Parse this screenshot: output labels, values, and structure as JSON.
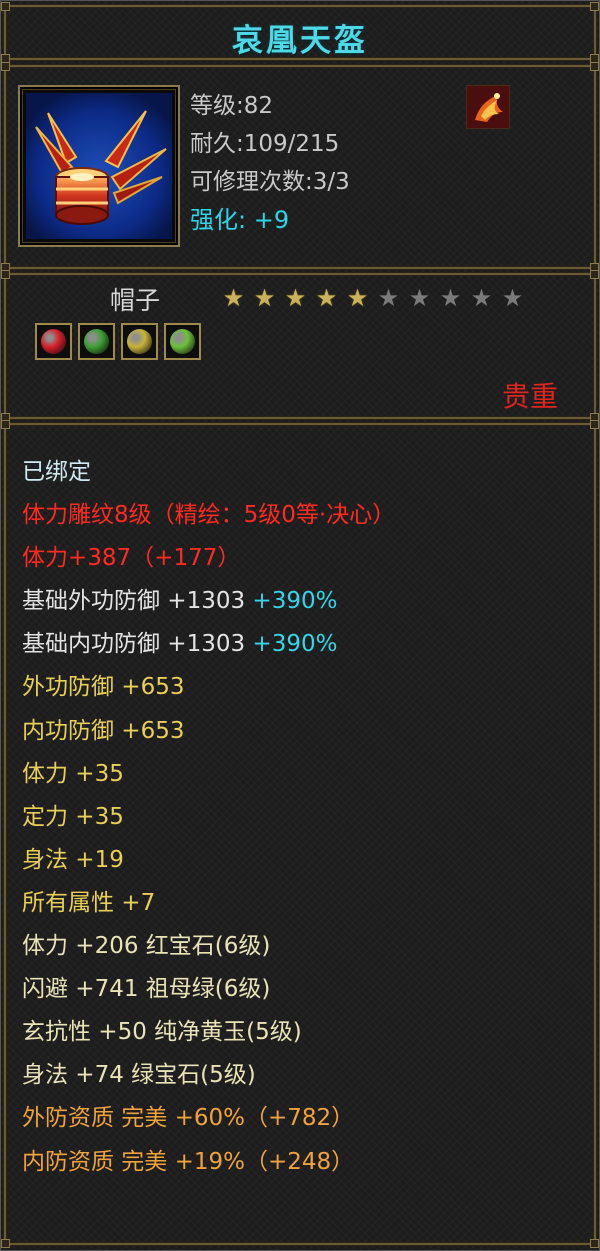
{
  "title": "哀凰天盔",
  "item": {
    "icon": "phoenix-helmet-icon",
    "level": "等级:82",
    "durability": "耐久:109/215",
    "repair_count": "可修理次数:3/3",
    "enhance_label": "强化:",
    "enhance_value": "+9",
    "badge_icon": "phoenix-badge-icon"
  },
  "meta": {
    "type": "帽子",
    "stars_filled": 5,
    "stars_total": 10,
    "rarity": "贵重",
    "gems": [
      {
        "icon": "red-gem-icon",
        "color": "#d8202a"
      },
      {
        "icon": "green-gem-icon",
        "color": "#3fa035"
      },
      {
        "icon": "yellow-gem-icon",
        "color": "#c8b43a"
      },
      {
        "icon": "lime-gem-icon",
        "color": "#6cc03a"
      }
    ]
  },
  "stats": [
    {
      "text": "已绑定",
      "extra": "",
      "color": "#cfe9f0"
    },
    {
      "text": "体力雕纹8级（精绘：5级0等·决心）",
      "extra": "",
      "color": "#ff2a1f"
    },
    {
      "text": "体力+387（+177）",
      "extra": "",
      "color": "#ff2a1f"
    },
    {
      "text": "基础外功防御 +1303",
      "extra": "+390%",
      "color": "#e4e4e4"
    },
    {
      "text": "基础内功防御 +1303",
      "extra": "+390%",
      "color": "#e4e4e4"
    },
    {
      "text": "外功防御 +653",
      "extra": "",
      "color": "#e9cf55"
    },
    {
      "text": "内功防御 +653",
      "extra": "",
      "color": "#e9cf55"
    },
    {
      "text": "体力 +35",
      "extra": "",
      "color": "#e9cf55"
    },
    {
      "text": "定力 +35",
      "extra": "",
      "color": "#e9cf55"
    },
    {
      "text": "身法 +19",
      "extra": "",
      "color": "#e9cf55"
    },
    {
      "text": "所有属性 +7",
      "extra": "",
      "color": "#e9cf55"
    },
    {
      "text": "体力 +206 红宝石(6级)",
      "extra": "",
      "color": "#e9e3b7"
    },
    {
      "text": "闪避 +741 祖母绿(6级)",
      "extra": "",
      "color": "#e9e3b7"
    },
    {
      "text": "玄抗性 +50 纯净黄玉(5级)",
      "extra": "",
      "color": "#e9e3b7"
    },
    {
      "text": "身法 +74 绿宝石(5级)",
      "extra": "",
      "color": "#e9e3b7"
    },
    {
      "text": "外防资质  完美 +60%（+782）",
      "extra": "",
      "color": "#f0a33a"
    },
    {
      "text": "内防资质  完美 +19%（+248）",
      "extra": "",
      "color": "#f0a33a"
    }
  ],
  "colors": {
    "title": "#4fd8e6",
    "frame": "#6b5a33",
    "rarity": "#e0241e"
  }
}
